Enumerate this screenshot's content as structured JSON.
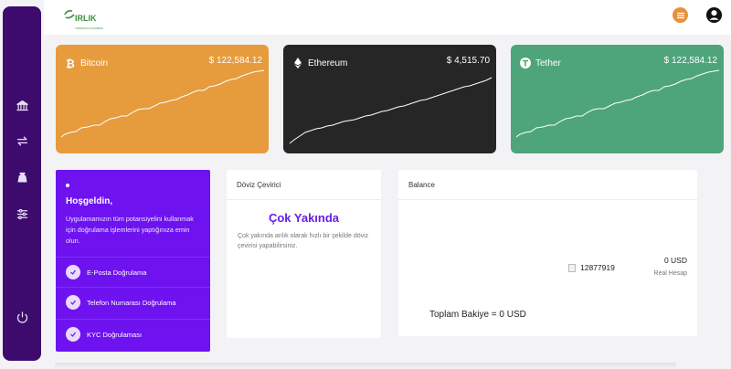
{
  "logo": {
    "text": "IRLIK",
    "subtext": "YATIRIM PLATFORMU"
  },
  "sidebar": {
    "items": [
      {
        "icon": "bank-icon"
      },
      {
        "icon": "transfer-icon"
      },
      {
        "icon": "money-bag-icon"
      },
      {
        "icon": "sliders-icon"
      },
      {
        "icon": "power-icon"
      }
    ]
  },
  "header": {
    "list_icon": "list-icon",
    "user_icon": "user-circle-icon"
  },
  "cards": [
    {
      "name": "Bitcoin",
      "price": "$ 122,584.12",
      "color": "#e69b3d",
      "icon": "bitcoin-icon"
    },
    {
      "name": "Ethereum",
      "price": "$ 4,515.70",
      "color": "#262626",
      "icon": "ethereum-icon"
    },
    {
      "name": "Tether",
      "price": "$ 122,584.12",
      "color": "#4ea57b",
      "icon": "tether-icon"
    }
  ],
  "welcome": {
    "title": "Hoşgeldin,",
    "text": "Uygulamamızın tüm potansiyelini kullanmak için doğrulama işlemlerini yaptığınıza emin olun.",
    "items": [
      "E-Posta Doğrulama",
      "Telefon Numarası Doğrulama",
      "KYC Doğrulaması"
    ],
    "color": "#6e12f0"
  },
  "doviz": {
    "title": "Döviz Çevirici",
    "soon": "Çok Yakında",
    "soon_text": "Çok yakında anlık olarak hızlı bir şekilde döviz çevirisi yapabilirsiniz."
  },
  "balance": {
    "title": "Balance",
    "account_id": "12877919",
    "account_balance": "0 USD",
    "account_type": "Real Hesap",
    "total": "Toplam Bakiye = 0 USD"
  }
}
